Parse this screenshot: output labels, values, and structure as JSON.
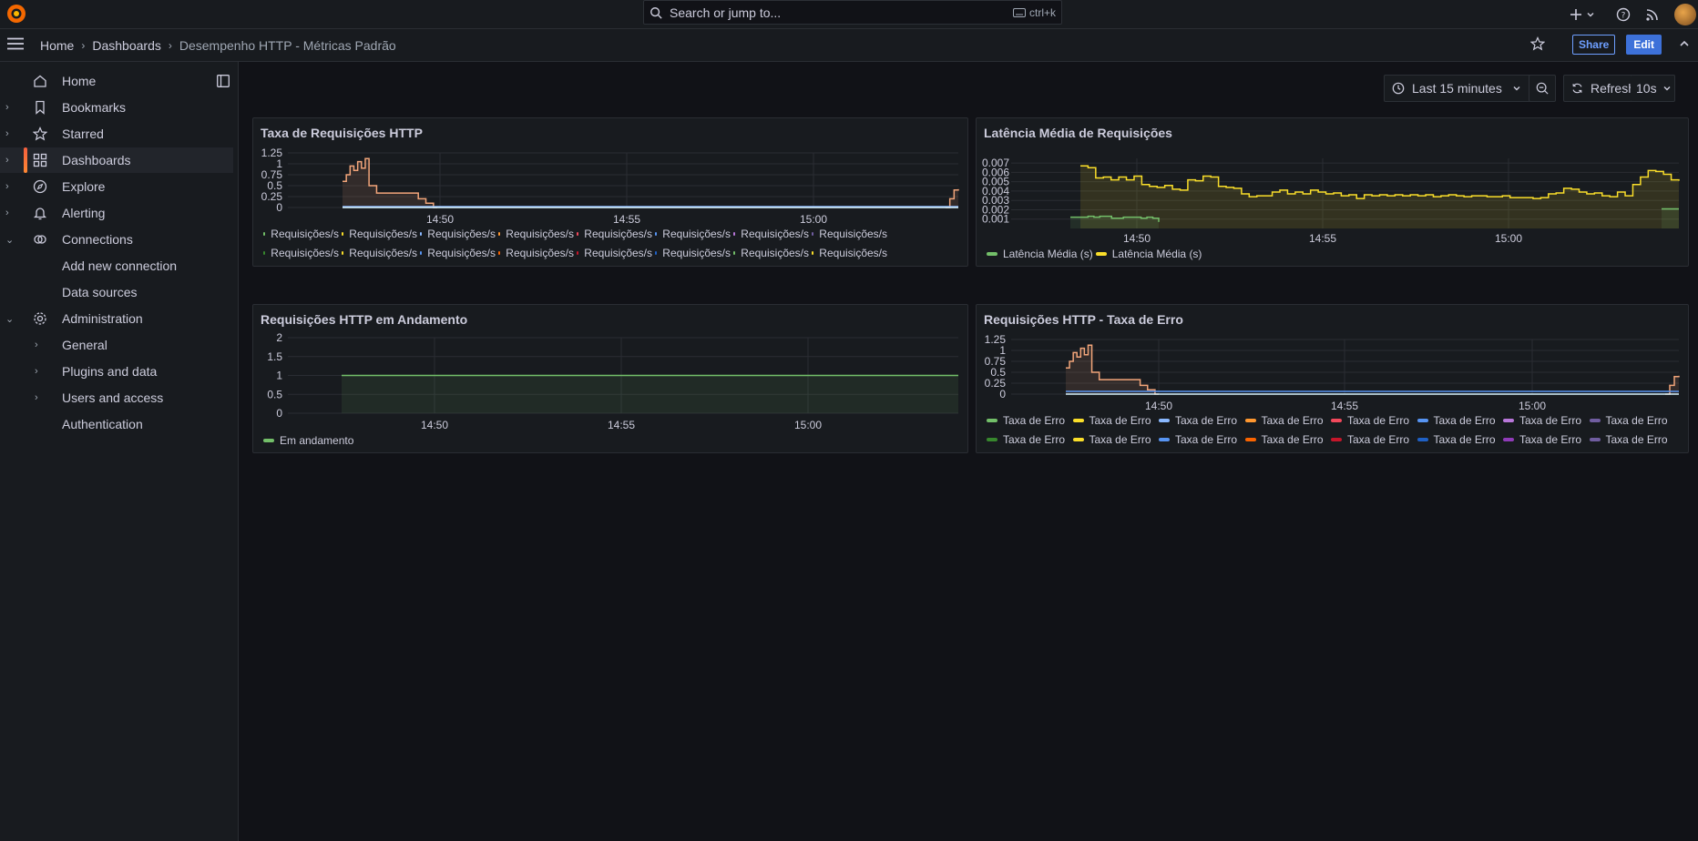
{
  "topbar": {
    "search_placeholder": "Search or jump to...",
    "search_shortcut": "ctrl+k"
  },
  "breadcrumb": {
    "home": "Home",
    "dashboards": "Dashboards",
    "current": "Desempenho HTTP - Métricas Padrão"
  },
  "actions": {
    "share": "Share",
    "edit": "Edit"
  },
  "sidebar": {
    "items": [
      {
        "label": "Home",
        "icon": "home-icon"
      },
      {
        "label": "Bookmarks",
        "icon": "bookmark-icon"
      },
      {
        "label": "Starred",
        "icon": "star-icon"
      },
      {
        "label": "Dashboards",
        "icon": "apps-icon"
      },
      {
        "label": "Explore",
        "icon": "compass-icon"
      },
      {
        "label": "Alerting",
        "icon": "bell-icon"
      },
      {
        "label": "Connections",
        "icon": "link-icon"
      },
      {
        "label": "Add new connection"
      },
      {
        "label": "Data sources"
      },
      {
        "label": "Administration",
        "icon": "cog-icon"
      },
      {
        "label": "General"
      },
      {
        "label": "Plugins and data"
      },
      {
        "label": "Users and access"
      },
      {
        "label": "Authentication"
      }
    ]
  },
  "toolbar": {
    "time_range": "Last 15 minutes",
    "refresh": "Refresh",
    "interval": "10s"
  },
  "colors": {
    "accent": "#3d71d9",
    "green": "#73bf69",
    "yellow": "#fade2a",
    "orange": "#ff9830",
    "salmon": "#f2a57a",
    "cyan": "#8ab8ff"
  },
  "panels": {
    "p1": {
      "title": "Taxa de Requisições HTTP",
      "legend_label": "Requisições/s",
      "chart_data": {
        "type": "line",
        "x_ticks": [
          "14:50",
          "14:55",
          "15:00"
        ],
        "y_ticks": [
          "1.25",
          "1",
          "0.75",
          "0.5",
          "0.25",
          "0"
        ],
        "ylim": [
          0,
          1.25
        ],
        "series": [
          {
            "name": "Requisições/s",
            "color": "#f2a57a",
            "x": [
              0,
              0.5,
              1,
              1.5,
              2,
              2.5,
              3,
              4,
              5,
              8,
              9,
              10,
              11,
              12,
              13,
              14,
              15,
              15.5,
              16,
              17,
              18,
              19,
              20,
              21,
              22,
              23,
              24,
              25,
              26,
              27,
              28,
              29,
              30,
              31,
              32,
              33,
              34,
              35,
              36,
              37,
              38,
              39,
              40,
              41,
              42,
              43,
              44,
              45,
              46,
              47,
              48,
              49,
              50,
              51,
              52,
              53,
              54,
              55,
              56,
              57,
              58,
              59,
              60,
              61,
              62,
              63,
              64,
              65,
              66,
              67,
              68,
              69,
              70,
              71,
              72,
              73,
              74,
              75,
              76,
              77,
              78,
              79,
              80,
              81,
              82,
              83,
              84,
              85,
              86,
              87,
              88,
              89,
              90,
              91,
              92,
              93,
              94,
              95,
              96,
              97,
              98,
              99,
              100,
              101,
              102,
              103,
              104,
              105,
              106,
              107,
              108,
              109,
              110,
              111,
              112,
              113,
              114,
              115,
              116,
              117,
              118,
              119,
              120,
              121,
              122,
              123,
              124,
              125,
              126,
              127,
              128,
              129,
              130,
              131,
              132,
              133,
              134,
              135,
              136,
              137,
              138,
              139,
              140,
              141,
              142,
              143,
              144,
              145,
              146,
              147,
              148,
              149,
              150,
              151,
              152,
              153,
              154,
              155,
              156,
              157,
              158,
              159,
              160,
              161,
              162,
              163,
              164,
              165,
              166,
              167,
              168,
              169,
              170,
              171,
              172,
              173,
              174,
              175,
              176,
              177,
              178,
              179,
              180,
              181,
              182,
              183,
              184,
              185,
              186,
              187,
              188,
              189,
              190,
              191,
              192,
              193,
              194,
              195,
              196,
              197,
              198,
              199,
              200,
              201,
              202,
              203,
              204,
              205,
              206,
              207,
              208,
              209,
              210,
              211,
              212,
              213,
              214,
              215,
              216,
              217,
              218,
              219,
              220,
              221,
              222,
              223,
              224,
              225,
              226,
              227,
              228,
              229,
              230,
              231,
              232,
              233,
              234,
              235,
              236,
              237,
              238,
              239,
              240,
              241,
              242,
              243,
              244,
              245,
              246,
              247,
              248,
              249,
              250,
              251,
              252,
              253,
              254,
              255,
              256,
              257,
              258,
              259,
              260,
              261,
              262,
              263,
              264,
              265,
              266,
              267,
              268,
              269,
              270,
              271,
              272,
              273,
              274,
              275,
              276,
              277,
              278,
              279,
              280,
              281,
              282,
              283,
              284,
              285,
              286,
              287,
              288,
              289,
              290,
              291,
              292,
              293,
              294,
              295,
              296,
              297,
              298,
              299,
              300
            ],
            "y": [
              0.6,
              0.75,
              0.95,
              0.85,
              1.05,
              0.9,
              1.12,
              0.5,
              0.5,
              0.33,
              0.33,
              0.33,
              0.33,
              0.33,
              0.33,
              0.33,
              0.33,
              0.33,
              0.33,
              0.33,
              0.2,
              0.2,
              0.1,
              0.1,
              0,
              0,
              0,
              0,
              0,
              0,
              0,
              0,
              0,
              0,
              0,
              0,
              0,
              0,
              0,
              0,
              0,
              0,
              0,
              0,
              0,
              0,
              0,
              0,
              0,
              0,
              0,
              0,
              0,
              0,
              0,
              0,
              0,
              0,
              0,
              0,
              0,
              0,
              0,
              0,
              0,
              0,
              0,
              0,
              0,
              0,
              0,
              0,
              0,
              0,
              0,
              0,
              0,
              0,
              0,
              0,
              0,
              0,
              0,
              0,
              0,
              0,
              0,
              0,
              0,
              0,
              0,
              0,
              0,
              0,
              0,
              0,
              0,
              0,
              0,
              0,
              0,
              0,
              0,
              0,
              0,
              0,
              0,
              0,
              0,
              0,
              0,
              0,
              0,
              0,
              0,
              0,
              0,
              0,
              0,
              0,
              0,
              0,
              0,
              0,
              0,
              0,
              0,
              0,
              0,
              0,
              0,
              0,
              0,
              0,
              0,
              0,
              0,
              0,
              0,
              0,
              0,
              0,
              0,
              0,
              0,
              0,
              0,
              0,
              0,
              0,
              0,
              0,
              0,
              0,
              0,
              0,
              0,
              0,
              0,
              0,
              0,
              0,
              0,
              0,
              0,
              0,
              0,
              0,
              0,
              0,
              0,
              0,
              0,
              0,
              0,
              0,
              0,
              0,
              0,
              0,
              0,
              0,
              0,
              0,
              0,
              0,
              0,
              0,
              0,
              0,
              0,
              0,
              0,
              0,
              0,
              0,
              0,
              0,
              0,
              0,
              0,
              0,
              0,
              0,
              0,
              0,
              0,
              0,
              0,
              0,
              0,
              0,
              0,
              0,
              0,
              0,
              0,
              0,
              0,
              0,
              0,
              0,
              0,
              0,
              0,
              0,
              0,
              0,
              0,
              0,
              0,
              0,
              0,
              0,
              0,
              0,
              0,
              0,
              0,
              0,
              0,
              0,
              0,
              0,
              0,
              0,
              0,
              0,
              0,
              0,
              0,
              0,
              0,
              0,
              0,
              0,
              0,
              0,
              0,
              0,
              0,
              0,
              0,
              0,
              0,
              0,
              0,
              0,
              0,
              0,
              0,
              0,
              0,
              0,
              0,
              0,
              0,
              0,
              0,
              0,
              0,
              0,
              0,
              0,
              0,
              0,
              0,
              0,
              0,
              0,
              0,
              0,
              0,
              0,
              0,
              0,
              0,
              0,
              0,
              0,
              0,
              0,
              0,
              0,
              0,
              0,
              0,
              0,
              0,
              0,
              0,
              0,
              0.2,
              0.4,
              0.42,
              0.42
            ]
          }
        ]
      },
      "legend_colors": [
        "#73bf69",
        "#fade2a",
        "#8ab8ff",
        "#ff9830",
        "#f2495c",
        "#5794f2",
        "#b877d9",
        "#705da0",
        "#37872d",
        "#fade2a",
        "#5794f2",
        "#fa6400",
        "#c4162a",
        "#1f60c4"
      ]
    },
    "p2": {
      "title": "Latência Média de Requisições",
      "chart_data": {
        "type": "area",
        "x_ticks": [
          "14:50",
          "14:55",
          "15:00"
        ],
        "y_ticks": [
          "0.007",
          "0.006",
          "0.005",
          "0.004",
          "0.003",
          "0.002",
          "0.001"
        ],
        "ylim": [
          0,
          0.0075
        ],
        "series": [
          {
            "name": "Latência Média (s)",
            "color": "#73bf69",
            "y": [
              0.0012,
              0.0012,
              0.0012,
              0.0013,
              0.0012,
              0.0013,
              0.0013,
              0.0011,
              0.0011,
              0.0012,
              0.0012,
              0.0012,
              0.0011,
              0.0012,
              0.0011,
              0.0007
            ]
          },
          {
            "name": "Latência Média (s)",
            "color": "#fade2a",
            "y": [
              0.0067,
              0.0065,
              0.0054,
              0.0055,
              0.0052,
              0.0055,
              0.0052,
              0.0056,
              0.0047,
              0.0045,
              0.0044,
              0.0046,
              0.0042,
              0.0041,
              0.0052,
              0.0051,
              0.0056,
              0.0055,
              0.0045,
              0.0044,
              0.0043,
              0.0037,
              0.0034,
              0.0035,
              0.0035,
              0.0039,
              0.0041,
              0.0037,
              0.0039,
              0.0037,
              0.0041,
              0.0039,
              0.0037,
              0.0038,
              0.0035,
              0.0036,
              0.0032,
              0.0036,
              0.0035,
              0.0036,
              0.0035,
              0.0036,
              0.0035,
              0.0036,
              0.0035,
              0.0036,
              0.0034,
              0.0035,
              0.0036,
              0.0035,
              0.0034,
              0.0035,
              0.0035,
              0.0034,
              0.0034,
              0.0035,
              0.0033,
              0.0033,
              0.0033,
              0.0032,
              0.0033,
              0.0037,
              0.0038,
              0.0043,
              0.0042,
              0.0039,
              0.0037,
              0.0038,
              0.0035,
              0.0034,
              0.0039,
              0.0035,
              0.0047,
              0.0055,
              0.0062,
              0.0061,
              0.0058,
              0.0052,
              0.0051
            ]
          }
        ]
      }
    },
    "p3": {
      "title": "Requisições HTTP em Andamento",
      "chart_data": {
        "type": "area",
        "x_ticks": [
          "14:50",
          "14:55",
          "15:00"
        ],
        "y_ticks": [
          "2",
          "1.5",
          "1",
          "0.5",
          "0"
        ],
        "ylim": [
          0,
          2
        ],
        "series": [
          {
            "name": "Em andamento",
            "color": "#73bf69",
            "y": [
              1,
              1
            ]
          }
        ]
      }
    },
    "p4": {
      "title": "Requisições HTTP - Taxa de Erro",
      "legend_label": "Taxa de Erro",
      "chart_data": {
        "type": "line",
        "x_ticks": [
          "14:50",
          "14:55",
          "15:00"
        ],
        "y_ticks": [
          "1.25",
          "1",
          "0.75",
          "0.5",
          "0.25",
          "0"
        ],
        "ylim": [
          0,
          1.25
        ],
        "series": [
          {
            "name": "Taxa de Erro",
            "color": "#f2a57a"
          }
        ]
      },
      "legend_colors": [
        "#73bf69",
        "#fade2a",
        "#8ab8ff",
        "#ff9830",
        "#f2495c",
        "#5794f2",
        "#b877d9",
        "#705da0",
        "#37872d",
        "#fade2a",
        "#5794f2",
        "#fa6400",
        "#c4162a",
        "#1f60c4",
        "#8f3bb8",
        "#705da0"
      ]
    }
  }
}
